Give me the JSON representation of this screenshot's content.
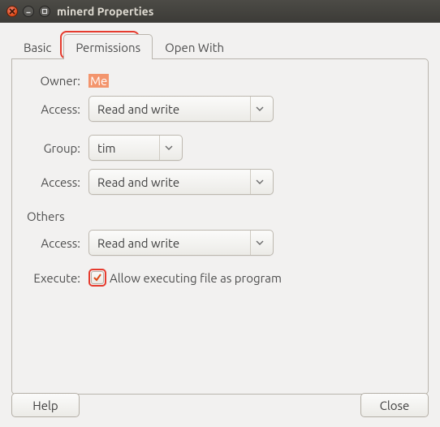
{
  "window": {
    "title": "minerd Properties"
  },
  "tabs": {
    "basic": "Basic",
    "permissions": "Permissions",
    "openwith": "Open With",
    "active": "permissions"
  },
  "labels": {
    "owner": "Owner:",
    "access": "Access:",
    "group": "Group:",
    "others": "Others",
    "execute": "Execute:"
  },
  "values": {
    "owner": "Me",
    "owner_access": "Read and write",
    "group": "tim",
    "group_access": "Read and write",
    "others_access": "Read and write",
    "execute_label": "Allow executing file as program",
    "execute_checked": true
  },
  "buttons": {
    "help": "Help",
    "close": "Close"
  }
}
